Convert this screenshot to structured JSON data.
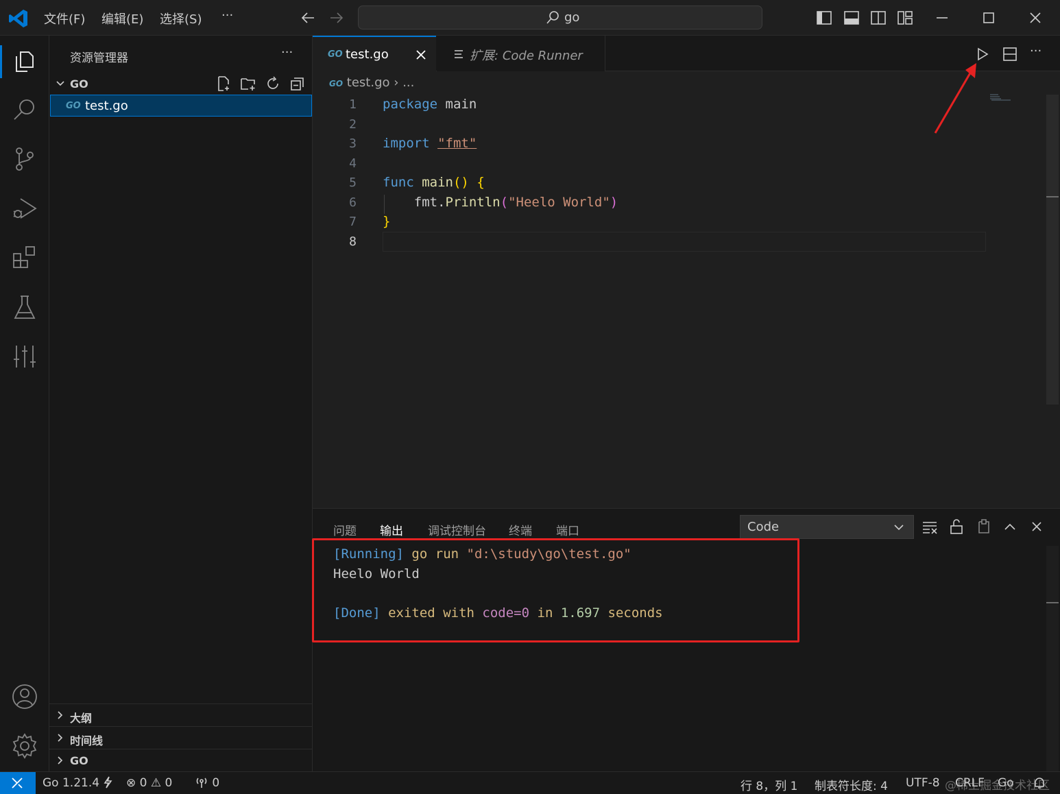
{
  "menu": {
    "file": "文件(F)",
    "edit": "编辑(E)",
    "select": "选择(S)",
    "more": "···"
  },
  "search": {
    "text": "go"
  },
  "sidebar": {
    "title": "资源管理器",
    "more": "···",
    "folder": "GO",
    "file": "test.go",
    "sections": [
      "大纲",
      "时间线",
      "GO"
    ]
  },
  "tabs": [
    {
      "label": "test.go",
      "icon": "go-icon"
    },
    {
      "prefix": "扩展:",
      "label": "Code Runner",
      "icon": "preview-icon"
    }
  ],
  "breadcrumb": {
    "file": "test.go",
    "more": "..."
  },
  "editor": {
    "line_numbers": [
      "1",
      "2",
      "3",
      "4",
      "5",
      "6",
      "7",
      "8"
    ],
    "tokens": {
      "package": "package",
      "main": "main",
      "import": "import",
      "fmt_str": "\"fmt\"",
      "func": "func",
      "main_fn": "main",
      "parens": "()",
      "brace_open": "{",
      "call_obj": "fmt.",
      "call_fn": "Println",
      "paren_open": "(",
      "hello_str": "\"Heelo World\"",
      "paren_close": ")",
      "brace_close": "}"
    }
  },
  "panel": {
    "tabs": [
      "问题",
      "输出",
      "调试控制台",
      "终端",
      "端口"
    ],
    "active_tab": "输出",
    "channel": "Code",
    "output": {
      "running": "[Running]",
      "cmd_go": "go",
      "cmd_run": "run",
      "cmd_path": "\"d:\\study\\go\\test.go\"",
      "result": "Heelo World",
      "done": "[Done]",
      "exited": "exited",
      "with": "with",
      "code": "code=0",
      "in": "in",
      "time": "1.697",
      "seconds": "seconds"
    }
  },
  "statusbar": {
    "go_version": "Go 1.21.4",
    "errors": "0",
    "warnings": "0",
    "ports": "0",
    "position": "行 8，列 1",
    "tab_size": "制表符长度: 4",
    "encoding": "UTF-8",
    "eol": "CRLF",
    "language": "Go",
    "watermark": "@稀土掘金技术社区"
  },
  "colors": {
    "accent": "#0078d4",
    "annotation": "#e52222",
    "keyword": "#569cd6",
    "function": "#dcdcaa",
    "string": "#ce9178"
  }
}
